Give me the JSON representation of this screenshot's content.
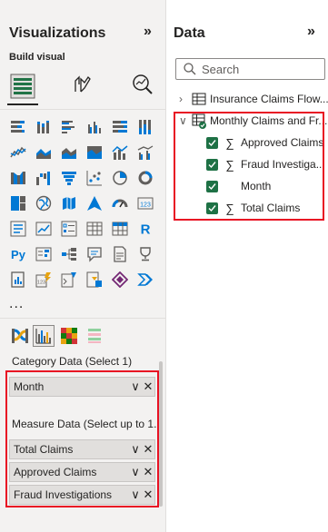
{
  "visualizations": {
    "title": "Visualizations",
    "build_visual_label": "Build visual",
    "more_label": "...",
    "wells": {
      "category_label": "Category Data (Select 1)",
      "category_fields": [
        {
          "label": "Month"
        }
      ],
      "measure_label": "Measure Data (Select up to 1...",
      "measure_fields": [
        {
          "label": "Total Claims"
        },
        {
          "label": "Approved Claims"
        },
        {
          "label": "Fraud Investigations"
        }
      ],
      "expand_glyph": "∨",
      "remove_glyph": "✕"
    }
  },
  "data": {
    "title": "Data",
    "search_placeholder": "Search",
    "tables": [
      {
        "name": "Insurance Claims Flow...",
        "expanded": false
      },
      {
        "name": "Monthly Claims and Fr...",
        "expanded": true,
        "fields": [
          {
            "label": "Approved Claims",
            "sigma": true,
            "checked": true
          },
          {
            "label": "Fraud Investiga...",
            "sigma": true,
            "checked": true
          },
          {
            "label": "Month",
            "sigma": false,
            "checked": true
          },
          {
            "label": "Total Claims",
            "sigma": true,
            "checked": true
          }
        ]
      }
    ],
    "sigma_glyph": "∑",
    "collapsed_chevron": "›",
    "expanded_chevron": "∨"
  },
  "collapse_glyph": "»",
  "accent_color": "#1e7145",
  "highlight_color": "#e81123"
}
